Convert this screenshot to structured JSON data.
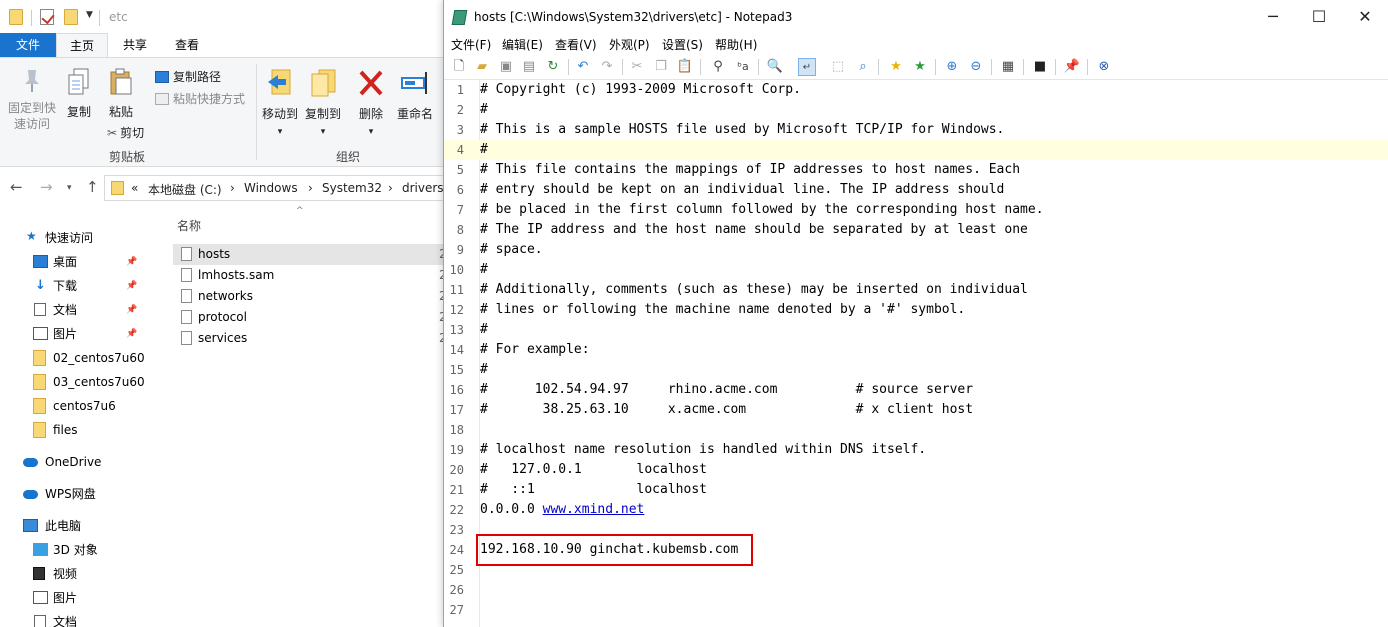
{
  "explorer": {
    "title": "etc",
    "tabs": [
      "文件",
      "主页",
      "共享",
      "查看"
    ],
    "ribbon": {
      "pin_label": "固定到快\n速访问",
      "copy_label": "复制",
      "paste_label": "粘贴",
      "copy_path_label": "复制路径",
      "paste_shortcut_label": "粘贴快捷方式",
      "cut_label": "剪切",
      "clipboard_group": "剪贴板",
      "move_to_label": "移动到",
      "copy_to_label": "复制到",
      "delete_label": "删除",
      "rename_label": "重命名",
      "organize_group": "组织"
    },
    "breadcrumb": [
      "«",
      "本地磁盘 (C:)",
      "Windows",
      "System32",
      "drivers"
    ],
    "nav": [
      {
        "label": "快速访问",
        "icon": "star-icon"
      },
      {
        "label": "桌面",
        "icon": "desktop-icon",
        "pinned": true
      },
      {
        "label": "下载",
        "icon": "download-icon",
        "pinned": true
      },
      {
        "label": "文档",
        "icon": "document-icon",
        "pinned": true
      },
      {
        "label": "图片",
        "icon": "picture-icon",
        "pinned": true
      },
      {
        "label": "02_centos7u60",
        "icon": "folder-icon"
      },
      {
        "label": "03_centos7u60",
        "icon": "folder-icon"
      },
      {
        "label": "centos7u6",
        "icon": "folder-icon"
      },
      {
        "label": "files",
        "icon": "folder-icon"
      },
      {
        "label": "OneDrive",
        "icon": "cloud-icon"
      },
      {
        "label": "WPS网盘",
        "icon": "wps-cloud-icon"
      },
      {
        "label": "此电脑",
        "icon": "computer-icon"
      },
      {
        "label": "3D 对象",
        "icon": "3d-objects-icon"
      },
      {
        "label": "视频",
        "icon": "video-icon"
      },
      {
        "label": "图片",
        "icon": "picture-icon"
      },
      {
        "label": "文档",
        "icon": "document-icon"
      }
    ],
    "column_header": "名称",
    "files": [
      {
        "name": "hosts",
        "selected": true,
        "extra": "2"
      },
      {
        "name": "lmhosts.sam",
        "extra": "2"
      },
      {
        "name": "networks",
        "extra": "2"
      },
      {
        "name": "protocol",
        "extra": "2"
      },
      {
        "name": "services",
        "extra": "2"
      }
    ]
  },
  "notepad": {
    "title": "hosts [C:\\Windows\\System32\\drivers\\etc] - Notepad3",
    "menu": [
      "文件(F)",
      "编辑(E)",
      "查看(V)",
      "外观(P)",
      "设置(S)",
      "帮助(H)"
    ],
    "current_line": 4,
    "highlighted_line": 24,
    "lines": [
      "# Copyright (c) 1993-2009 Microsoft Corp.",
      "#",
      "# This is a sample HOSTS file used by Microsoft TCP/IP for Windows.",
      "#",
      "# This file contains the mappings of IP addresses to host names. Each",
      "# entry should be kept on an individual line. The IP address should",
      "# be placed in the first column followed by the corresponding host name.",
      "# The IP address and the host name should be separated by at least one",
      "# space.",
      "#",
      "# Additionally, comments (such as these) may be inserted on individual",
      "# lines or following the machine name denoted by a '#' symbol.",
      "#",
      "# For example:",
      "#",
      "#      102.54.94.97     rhino.acme.com          # source server",
      "#       38.25.63.10     x.acme.com              # x client host",
      "",
      "# localhost name resolution is handled within DNS itself.",
      "#   127.0.0.1       localhost",
      "#   ::1             localhost",
      "0.0.0.0 ",
      "",
      "192.168.10.90 ginchat.kubemsb.com",
      "",
      "",
      ""
    ],
    "link_text": "www.xmind.net",
    "colors": {
      "current_line_bg": "#ffffe0",
      "highlight_border": "#e00000",
      "link": "#0000cc"
    }
  }
}
